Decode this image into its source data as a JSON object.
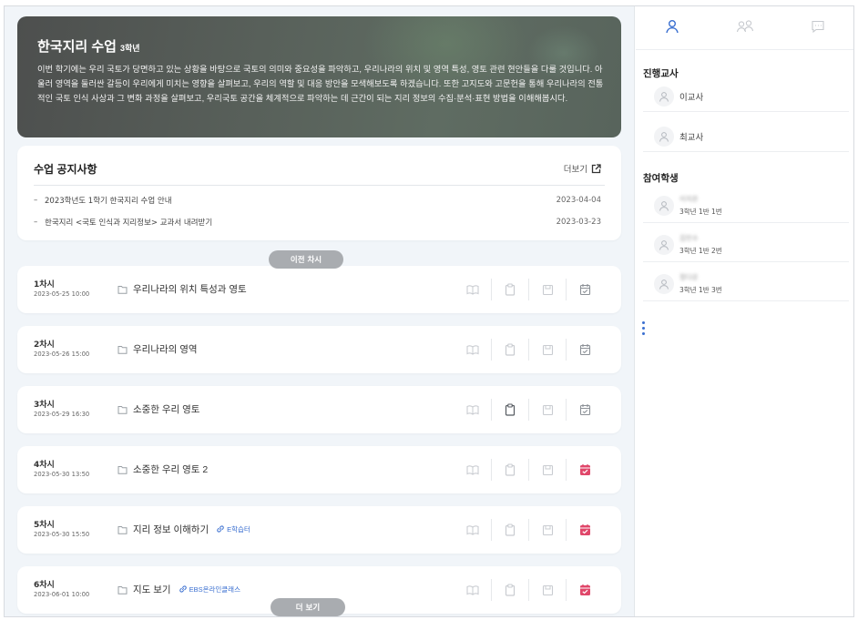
{
  "course": {
    "title": "한국지리 수업",
    "grade": "3학년",
    "description": "이번 학기에는 우리 국토가 당면하고 있는 상황을 바탕으로 국토의 의미와 중요성을 파악하고, 우리나라의 위치 및 영역 특성, 영토 관련 현안들을 다룰 것입니다. 아울러 영역을 둘러싼 갈등이 우리에게 미치는 영향을 살펴보고, 우리의 역할 및 대응 방안을 모색해보도록 하겠습니다. 또한 고지도와 고문헌을 통해 우리나라의 전통적인 국토 인식 사상과 그 변화 과정을 살펴보고, 우리국토 공간을 체계적으로 파악하는 데 근간이 되는 지리 정보의 수집·분석·표현 방법을 이해해봅시다."
  },
  "notice": {
    "title": "수업 공지사항",
    "more_label": "더보기",
    "items": [
      {
        "title": "2023학년도 1학기 한국지리 수업 안내",
        "date": "2023-04-04"
      },
      {
        "title": "한국지리 <국토 인식과 지리정보> 교과서 내려받기",
        "date": "2023-03-23"
      }
    ]
  },
  "prev_sessions_label": "이전 차시",
  "more_sessions_label": "더 보기",
  "sessions": [
    {
      "label": "1차시",
      "date": "2023-05-25 10:00",
      "title": "우리나라의 위치 특성과 영토",
      "link": "",
      "icons": [
        "book-icon",
        "clipboard-icon",
        "save-icon",
        "calendar-check-icon"
      ],
      "active": [
        false,
        false,
        false,
        false
      ],
      "highlight": false
    },
    {
      "label": "2차시",
      "date": "2023-05-26 15:00",
      "title": "우리나라의 영역",
      "link": "",
      "icons": [
        "book-icon",
        "clipboard-icon",
        "save-icon",
        "calendar-check-icon"
      ],
      "active": [
        false,
        false,
        false,
        false
      ],
      "highlight": false
    },
    {
      "label": "3차시",
      "date": "2023-05-29 16:30",
      "title": "소중한 우리 영토",
      "link": "",
      "icons": [
        "book-icon",
        "clipboard-icon",
        "save-icon",
        "calendar-check-icon"
      ],
      "active": [
        false,
        true,
        false,
        false
      ],
      "highlight": false
    },
    {
      "label": "4차시",
      "date": "2023-05-30 13:50",
      "title": "소중한 우리 영토 2",
      "link": "",
      "icons": [
        "book-icon",
        "clipboard-icon",
        "save-icon",
        "calendar-check-icon"
      ],
      "active": [
        false,
        false,
        false,
        false
      ],
      "highlight": true
    },
    {
      "label": "5차시",
      "date": "2023-05-30 15:50",
      "title": "지리 정보 이해하기",
      "link": "E학습터",
      "icons": [
        "book-icon",
        "clipboard-icon",
        "save-icon",
        "calendar-check-icon"
      ],
      "active": [
        false,
        false,
        false,
        false
      ],
      "highlight": true
    },
    {
      "label": "6차시",
      "date": "2023-06-01 10:00",
      "title": "지도 보기",
      "link": "EBS온라인클래스",
      "icons": [
        "book-icon",
        "clipboard-icon",
        "save-icon",
        "calendar-check-icon"
      ],
      "active": [
        false,
        false,
        false,
        false
      ],
      "highlight": true
    }
  ],
  "colors": {
    "accent": "#3a6fd0",
    "highlight": "#e0476a",
    "icon_muted": "#c9ccd1",
    "icon_active": "#555a60"
  },
  "sidebar": {
    "tabs": [
      {
        "icon": "person-icon",
        "active": true
      },
      {
        "icon": "people-icon",
        "active": false
      },
      {
        "icon": "chat-icon",
        "active": false
      }
    ],
    "teachers_title": "진행교사",
    "teachers": [
      "이교사",
      "최교사"
    ],
    "students_title": "참여학생",
    "students": [
      {
        "name": "이지은",
        "info": "3학년 1반 1번"
      },
      {
        "name": "김민수",
        "info": "3학년 1반 2번"
      },
      {
        "name": "정다운",
        "info": "3학년 1반 3번"
      }
    ]
  }
}
